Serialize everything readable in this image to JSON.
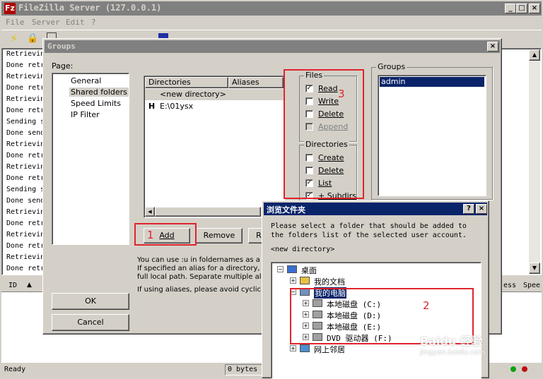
{
  "app": {
    "title": "FileZilla Server (127.0.0.1)",
    "menu": [
      "File",
      "Server",
      "Edit",
      "?"
    ],
    "log_lines": [
      "Retrievin",
      "Done retr",
      "Retrievin",
      "Done retr",
      "Retrievin",
      "Done retr",
      "Sending s",
      "Done send",
      "Retrievin",
      "Done retr",
      "Retrievin",
      "Done retr",
      "Sending s",
      "Done send",
      "Retrievin",
      "Done retr",
      "Retrievin",
      "Done retr",
      "Retrievin",
      "Done retr"
    ],
    "table_headers": {
      "id": "ID",
      "sort_arrow": "▲",
      "bytes": "ess",
      "speed": "Spee"
    },
    "status_ready": "Ready",
    "status_bytes": "0 bytes"
  },
  "groups_dialog": {
    "title": "Groups",
    "page_label": "Page:",
    "pages": [
      "General",
      "Shared folders",
      "Speed Limits",
      "IP Filter"
    ],
    "selected_page": "Shared folders",
    "dir_headers": {
      "directories": "Directories",
      "aliases": "Aliases"
    },
    "dir_rows": [
      {
        "prefix": "",
        "name": "<new directory>"
      },
      {
        "prefix": "H",
        "name": "E:\\01ysx"
      }
    ],
    "files_group": {
      "title": "Files",
      "items": [
        {
          "label": "Read",
          "checked": true
        },
        {
          "label": "Write",
          "checked": false
        },
        {
          "label": "Delete",
          "checked": false
        },
        {
          "label": "Append",
          "checked": false,
          "disabled": true
        }
      ]
    },
    "dirs_group": {
      "title": "Directories",
      "items": [
        {
          "label": "Create",
          "checked": false
        },
        {
          "label": "Delete",
          "checked": false
        },
        {
          "label": "List",
          "checked": true
        },
        {
          "label": "+ Subdirs",
          "checked": true
        }
      ]
    },
    "groups_title": "Groups",
    "groups_list": [
      "admin"
    ],
    "add_button": "Add",
    "remove_button": "Remove",
    "rename_button": "R",
    "help_lines": [
      "You can use :u in foldernames as a pl",
      "If specified an alias for a directory, it w",
      "full local path. Separate multiple aliase",
      "If using aliases, please avoid cyclic dir"
    ],
    "ok_button": "OK",
    "cancel_button": "Cancel"
  },
  "browse_dialog": {
    "title": "浏览文件夹",
    "help_btn": "?",
    "close_btn": "×",
    "message_line1": "Please select a folder that should be added to",
    "message_line2": "the folders list of the selected user account.",
    "current": "<new directory>",
    "tree": [
      {
        "label": "桌面",
        "level": 0,
        "expander": "−"
      },
      {
        "label": "我的文档",
        "level": 1,
        "expander": "+"
      },
      {
        "label": "我的电脑",
        "level": 1,
        "expander": "−"
      },
      {
        "label": "本地磁盘 (C:)",
        "level": 2,
        "expander": "+"
      },
      {
        "label": "本地磁盘 (D:)",
        "level": 2,
        "expander": "+"
      },
      {
        "label": "本地磁盘 (E:)",
        "level": 2,
        "expander": "+"
      },
      {
        "label": "DVD 驱动器 (F:)",
        "level": 2,
        "expander": "+"
      },
      {
        "label": "网上邻居",
        "level": 1,
        "expander": "+"
      }
    ]
  },
  "annotations": {
    "n1": "1",
    "n2": "2",
    "n3": "3"
  },
  "watermark": {
    "line1": "Baidu 经验",
    "line2": "jingyan.baidu.com"
  },
  "colors": {
    "title_active": "#0a246a",
    "title_inactive": "#808080",
    "selection": "#0a246a",
    "annotation": "#e0242c"
  }
}
